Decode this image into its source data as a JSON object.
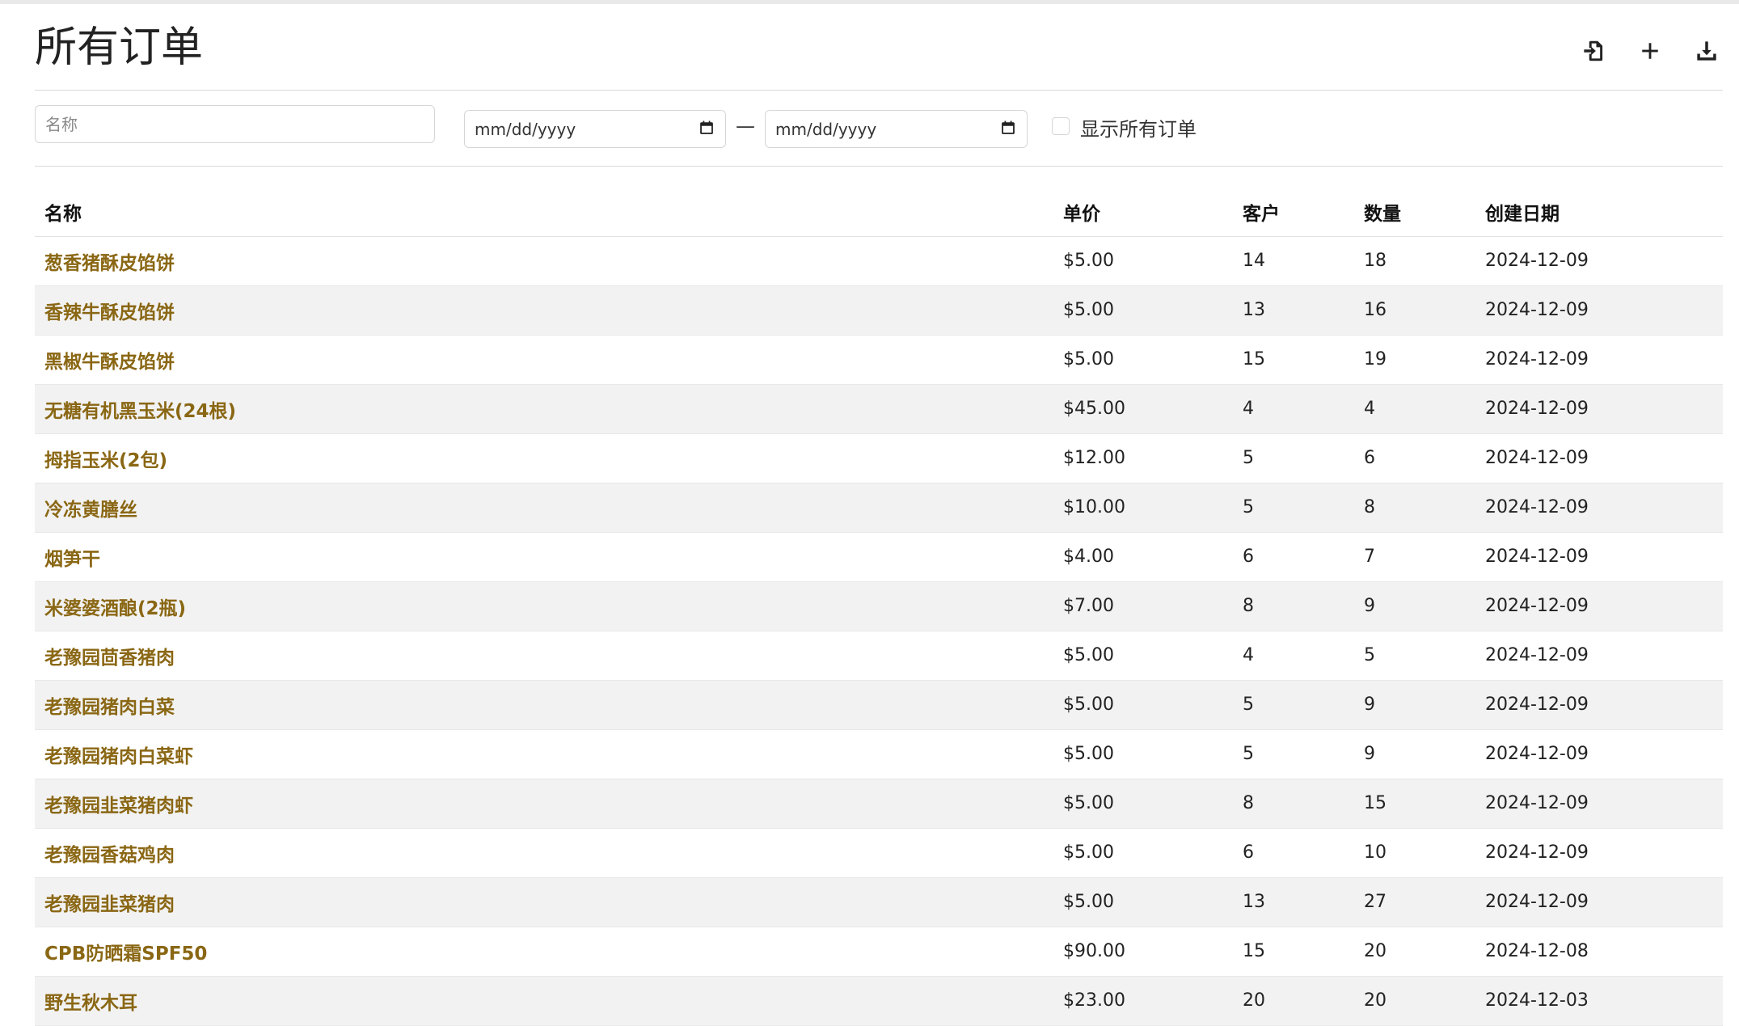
{
  "page": {
    "title": "所有订单"
  },
  "toolbar": {
    "import_icon": "file-import-icon",
    "add_icon": "plus-icon",
    "download_icon": "download-icon"
  },
  "filters": {
    "name_placeholder": "名称",
    "date_from_placeholder": "mm/dd/yyyy",
    "date_separator": "—",
    "date_to_placeholder": "mm/dd/yyyy",
    "show_all_label": "显示所有订单",
    "show_all_checked": false
  },
  "table": {
    "columns": [
      "名称",
      "单价",
      "客户",
      "数量",
      "创建日期"
    ],
    "rows": [
      {
        "name": "葱香猪酥皮馅饼",
        "price": "$5.00",
        "customers": "14",
        "quantity": "18",
        "created": "2024-12-09"
      },
      {
        "name": "香辣牛酥皮馅饼",
        "price": "$5.00",
        "customers": "13",
        "quantity": "16",
        "created": "2024-12-09"
      },
      {
        "name": "黑椒牛酥皮馅饼",
        "price": "$5.00",
        "customers": "15",
        "quantity": "19",
        "created": "2024-12-09"
      },
      {
        "name": "无糖有机黑玉米(24根)",
        "price": "$45.00",
        "customers": "4",
        "quantity": "4",
        "created": "2024-12-09"
      },
      {
        "name": "拇指玉米(2包)",
        "price": "$12.00",
        "customers": "5",
        "quantity": "6",
        "created": "2024-12-09"
      },
      {
        "name": "冷冻黄膳丝",
        "price": "$10.00",
        "customers": "5",
        "quantity": "8",
        "created": "2024-12-09"
      },
      {
        "name": "烟笋干",
        "price": "$4.00",
        "customers": "6",
        "quantity": "7",
        "created": "2024-12-09"
      },
      {
        "name": "米婆婆酒酿(2瓶)",
        "price": "$7.00",
        "customers": "8",
        "quantity": "9",
        "created": "2024-12-09"
      },
      {
        "name": "老豫园茴香猪肉",
        "price": "$5.00",
        "customers": "4",
        "quantity": "5",
        "created": "2024-12-09"
      },
      {
        "name": "老豫园猪肉白菜",
        "price": "$5.00",
        "customers": "5",
        "quantity": "9",
        "created": "2024-12-09"
      },
      {
        "name": "老豫园猪肉白菜虾",
        "price": "$5.00",
        "customers": "5",
        "quantity": "9",
        "created": "2024-12-09"
      },
      {
        "name": "老豫园韭菜猪肉虾",
        "price": "$5.00",
        "customers": "8",
        "quantity": "15",
        "created": "2024-12-09"
      },
      {
        "name": "老豫园香菇鸡肉",
        "price": "$5.00",
        "customers": "6",
        "quantity": "10",
        "created": "2024-12-09"
      },
      {
        "name": "老豫园韭菜猪肉",
        "price": "$5.00",
        "customers": "13",
        "quantity": "27",
        "created": "2024-12-09"
      },
      {
        "name": "CPB防晒霜SPF50",
        "price": "$90.00",
        "customers": "15",
        "quantity": "20",
        "created": "2024-12-08"
      },
      {
        "name": "野生秋木耳",
        "price": "$23.00",
        "customers": "20",
        "quantity": "20",
        "created": "2024-12-03"
      }
    ]
  }
}
